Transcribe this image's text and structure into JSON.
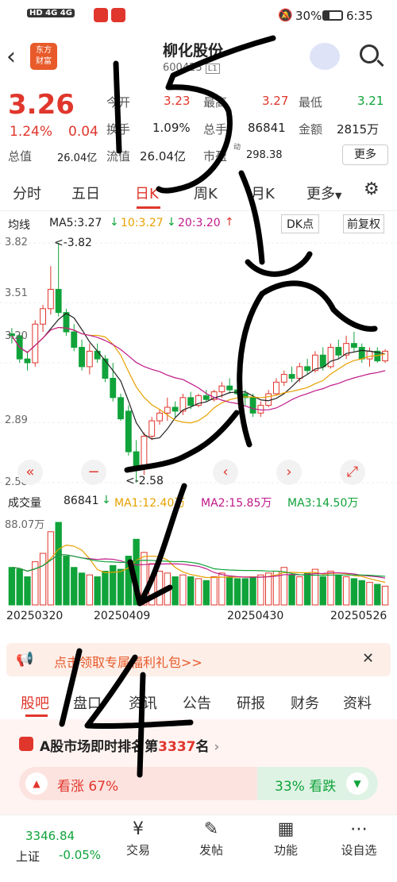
{
  "status_bar": {
    "left_icons": "HD 4G 4G",
    "battery": "30%",
    "time": "6:35"
  },
  "header": {
    "logo_line1": "东方",
    "logo_line2": "财富",
    "stock_name": "柳化股份",
    "stock_code": "600423",
    "market_tag": "L1"
  },
  "quote": {
    "price": "3.26",
    "change_pct": "1.24%",
    "change": "0.04",
    "open_label": "今开",
    "open": "3.23",
    "high_label": "最高",
    "high": "3.27",
    "low_label": "最低",
    "low": "3.21",
    "turnover_label": "换手",
    "turnover": "1.09%",
    "volume_label": "总手",
    "volume": "86841",
    "amount_label": "金额",
    "amount": "2815万",
    "total_value_label": "总值",
    "total_value": "26.04亿",
    "float_value_label": "流值",
    "float_value": "26.04亿",
    "pe_label": "市盈",
    "pe_sup": "动",
    "pe": "298.38",
    "more_button": "更多"
  },
  "tabs": [
    "分时",
    "五日",
    "日K",
    "周K",
    "月K",
    "更多",
    "⚙"
  ],
  "active_tab": "日K",
  "indicator_bar": {
    "line_type": "均线",
    "ma5": "MA5:3.27",
    "ma10": "10:3.27",
    "ma20": "20:3.20",
    "dk": "DK点",
    "restore": "前复权"
  },
  "price_axis": [
    "3.82",
    "3.51",
    "3.20",
    "2.89",
    "2.58"
  ],
  "annotations": {
    "max": "<-3.82",
    "min": "<-2.58"
  },
  "volume_bar": {
    "label": "成交量",
    "value": "86841",
    "ma1": "MA1:12.40万",
    "ma2": "MA2:15.85万",
    "ma3": "MA3:14.50万"
  },
  "volume_axis_top": "88.07万",
  "dates": [
    "20250320",
    "20250409",
    "20250430",
    "20250526"
  ],
  "chart_data": {
    "type": "candlestick",
    "candles": [
      [
        3.35,
        3.38,
        3.3,
        3.34
      ],
      [
        3.34,
        3.36,
        3.2,
        3.22
      ],
      [
        3.22,
        3.26,
        3.16,
        3.2
      ],
      [
        3.2,
        3.42,
        3.18,
        3.4
      ],
      [
        3.4,
        3.5,
        3.36,
        3.48
      ],
      [
        3.48,
        3.7,
        3.45,
        3.58
      ],
      [
        3.58,
        3.82,
        3.44,
        3.46
      ],
      [
        3.46,
        3.48,
        3.34,
        3.36
      ],
      [
        3.36,
        3.4,
        3.26,
        3.28
      ],
      [
        3.28,
        3.32,
        3.16,
        3.18
      ],
      [
        3.18,
        3.3,
        3.14,
        3.26
      ],
      [
        3.26,
        3.3,
        3.2,
        3.22
      ],
      [
        3.22,
        3.24,
        3.1,
        3.12
      ],
      [
        3.12,
        3.2,
        3.0,
        3.02
      ],
      [
        3.02,
        3.04,
        2.9,
        2.91
      ],
      [
        2.95,
        2.98,
        2.72,
        2.74
      ],
      [
        2.74,
        2.8,
        2.58,
        2.66
      ],
      [
        2.66,
        2.84,
        2.62,
        2.82
      ],
      [
        2.82,
        2.92,
        2.8,
        2.9
      ],
      [
        2.9,
        2.96,
        2.88,
        2.94
      ],
      [
        2.94,
        3.02,
        2.9,
        2.97
      ],
      [
        2.97,
        3.0,
        2.92,
        2.95
      ],
      [
        2.95,
        3.04,
        2.93,
        3.02
      ],
      [
        3.02,
        3.05,
        2.96,
        2.98
      ],
      [
        2.98,
        3.04,
        2.97,
        3.03
      ],
      [
        3.03,
        3.06,
        3.0,
        3.01
      ],
      [
        3.01,
        3.06,
        3.0,
        3.05
      ],
      [
        3.05,
        3.1,
        3.02,
        3.08
      ],
      [
        3.08,
        3.12,
        3.04,
        3.06
      ],
      [
        3.06,
        3.1,
        3.03,
        3.04
      ],
      [
        3.04,
        3.06,
        2.98,
        3.02
      ],
      [
        3.02,
        3.04,
        2.92,
        2.94
      ],
      [
        2.94,
        3.0,
        2.92,
        2.98
      ],
      [
        2.98,
        3.06,
        2.97,
        3.04
      ],
      [
        3.04,
        3.12,
        3.03,
        3.1
      ],
      [
        3.1,
        3.16,
        3.08,
        3.14
      ],
      [
        3.14,
        3.18,
        3.1,
        3.12
      ],
      [
        3.12,
        3.2,
        3.1,
        3.18
      ],
      [
        3.18,
        3.22,
        3.14,
        3.16
      ],
      [
        3.16,
        3.26,
        3.15,
        3.24
      ],
      [
        3.24,
        3.28,
        3.16,
        3.18
      ],
      [
        3.18,
        3.3,
        3.17,
        3.28
      ],
      [
        3.28,
        3.32,
        3.22,
        3.24
      ],
      [
        3.24,
        3.34,
        3.22,
        3.3
      ],
      [
        3.3,
        3.36,
        3.26,
        3.28
      ],
      [
        3.28,
        3.3,
        3.2,
        3.22
      ],
      [
        3.22,
        3.28,
        3.18,
        3.26
      ],
      [
        3.26,
        3.28,
        3.2,
        3.21
      ],
      [
        3.21,
        3.27,
        3.2,
        3.26
      ]
    ],
    "volume": [
      40,
      38,
      30,
      46,
      55,
      78,
      88,
      52,
      40,
      34,
      32,
      30,
      36,
      42,
      38,
      52,
      70,
      56,
      44,
      36,
      34,
      30,
      32,
      30,
      28,
      26,
      30,
      34,
      30,
      28,
      28,
      30,
      32,
      34,
      36,
      40,
      32,
      30,
      34,
      38,
      30,
      36,
      32,
      30,
      28,
      26,
      24,
      22,
      20
    ],
    "ylim": [
      2.58,
      3.82
    ]
  },
  "banner": {
    "text": "点击领取专属福利礼包>>",
    "close": "✕"
  },
  "sub_tabs": [
    "股吧",
    "盘口",
    "资讯",
    "公告",
    "研报",
    "财务",
    "资料"
  ],
  "active_sub_tab": "股吧",
  "rank": {
    "prefix": "A股市场即时排名第",
    "number": "3337",
    "suffix": "名"
  },
  "sentiment": {
    "up_label": "看涨 67%",
    "down_label": "33% 看跌"
  },
  "bottom_bar": {
    "index_value": "3346.84",
    "index_name": "上证",
    "index_change": "-0.05%",
    "items": [
      "交易",
      "发帖",
      "功能",
      "设自选"
    ]
  },
  "handwriting": [
    "15",
    "14"
  ]
}
